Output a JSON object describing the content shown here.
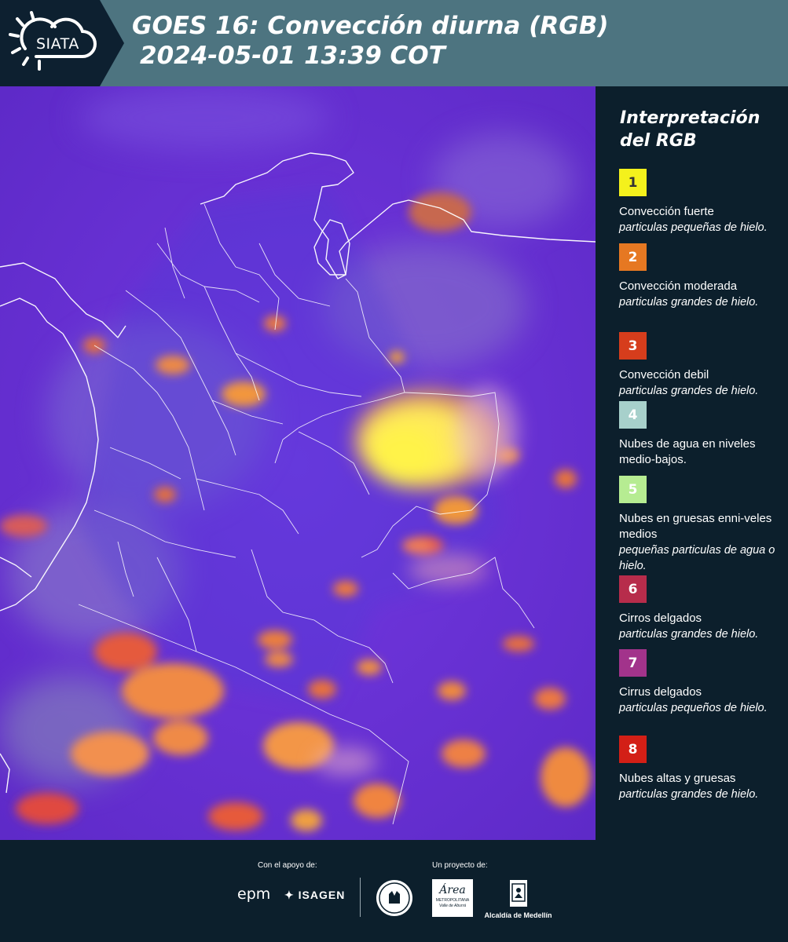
{
  "header": {
    "logo_text": "SIATA",
    "title_line1": "GOES 16: Convección diurna (RGB)",
    "title_line2": "2024-05-01 13:39 COT"
  },
  "legend": {
    "title": "Interpretación del RGB",
    "items": [
      {
        "number": "1",
        "color": "#f4f11c",
        "text_color": "#333333",
        "name": "Convección fuerte",
        "desc": "particulas pequeñas de hielo."
      },
      {
        "number": "2",
        "color": "#e67822",
        "text_color": "#ffffff",
        "name": "Convección moderada",
        "desc": "particulas grandes de hielo."
      },
      {
        "number": "3",
        "color": "#d63d1c",
        "text_color": "#ffffff",
        "name": "Convección debil",
        "desc": "particulas grandes de hielo."
      },
      {
        "number": "4",
        "color": "#a7d0cb",
        "text_color": "#ffffff",
        "name": "Nubes de agua en niveles medio-bajos.",
        "desc": ""
      },
      {
        "number": "5",
        "color": "#b6ec92",
        "text_color": "#ffffff",
        "name": "Nubes en gruesas enni-veles medios",
        "desc": "pequeñas particulas de agua o hielo."
      },
      {
        "number": "6",
        "color": "#b72c4b",
        "text_color": "#ffffff",
        "name": "Cirros delgados",
        "desc": "particulas grandes de hielo."
      },
      {
        "number": "7",
        "color": "#a2338b",
        "text_color": "#ffffff",
        "name": "Cirrus delgados",
        "desc": "particulas pequeños de hielo."
      },
      {
        "number": "8",
        "color": "#d31f16",
        "text_color": "#ffffff",
        "name": "Nubes altas y gruesas",
        "desc": "particulas grandes de hielo."
      }
    ]
  },
  "footer": {
    "support_label": "Con el apoyo de:",
    "project_label": "Un proyecto de:",
    "sponsors": {
      "epm": "epm",
      "isagen": "ISAGEN",
      "area": "Área",
      "area_sub1": "METROPOLITANA",
      "area_sub2": "Valle de Aburrá",
      "alcaldia": "Alcaldía de Medellín"
    }
  },
  "colors": {
    "header_bg": "#4d7480",
    "panel_bg": "#0c1f2c",
    "map_base": "#6a2fd8"
  }
}
